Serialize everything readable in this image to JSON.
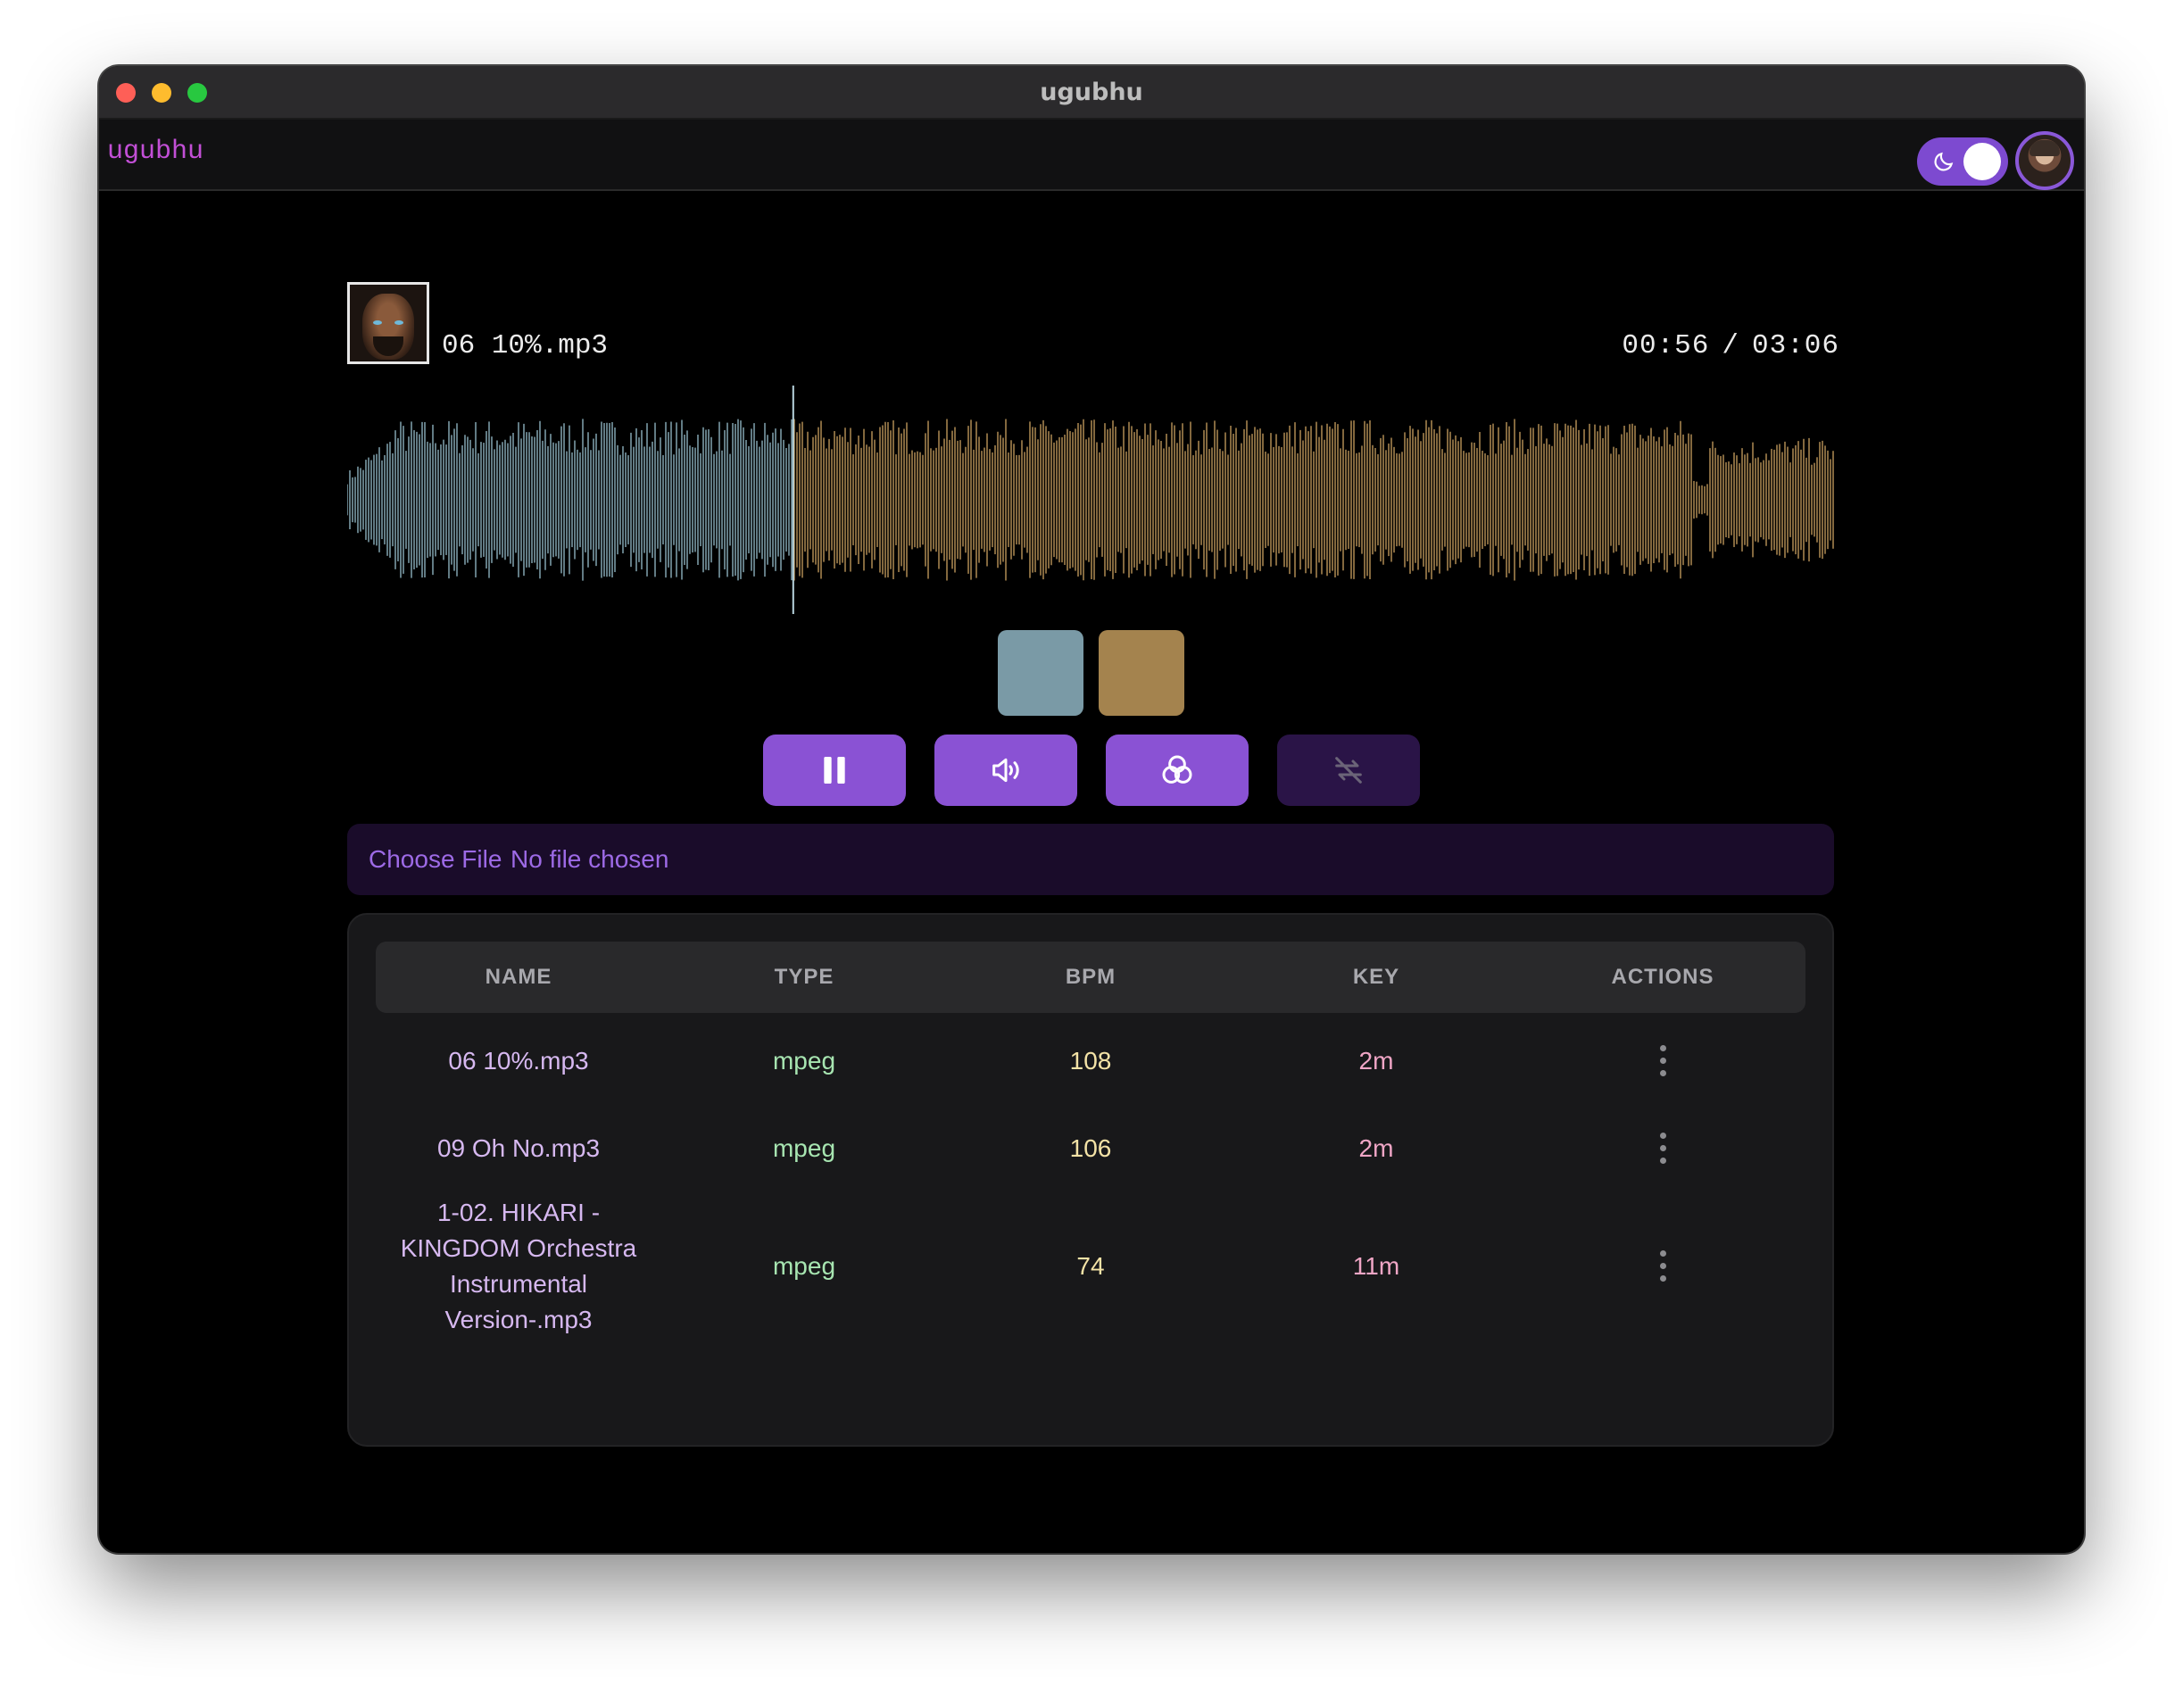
{
  "window": {
    "title": "ugubhu"
  },
  "navbar": {
    "brand": "ugubhu",
    "theme_mode": "dark"
  },
  "player": {
    "track_name": "06 10%.mp3",
    "current_time": "00:56",
    "time_separator": "/",
    "duration": "03:06",
    "progress": 0.3,
    "colors": {
      "played": "#7a9aa6",
      "unplayed": "#a4834e"
    }
  },
  "controls": {
    "pause": "pause-icon",
    "volume": "volume-icon",
    "effects": "effects-icon",
    "loop": "loop-icon",
    "accent": "#8a52d4"
  },
  "file_input": {
    "button_label": "Choose File",
    "status": "No file chosen"
  },
  "table": {
    "headers": [
      "NAME",
      "TYPE",
      "BPM",
      "KEY",
      "ACTIONS"
    ],
    "rows": [
      {
        "name": "06 10%.mp3",
        "type": "mpeg",
        "bpm": "108",
        "key": "2m"
      },
      {
        "name": "09 Oh No.mp3",
        "type": "mpeg",
        "bpm": "106",
        "key": "2m"
      },
      {
        "name": "1-02. HIKARI - KINGDOM Orchestra Instrumental Version-.mp3",
        "type": "mpeg",
        "bpm": "74",
        "key": "11m"
      }
    ]
  }
}
